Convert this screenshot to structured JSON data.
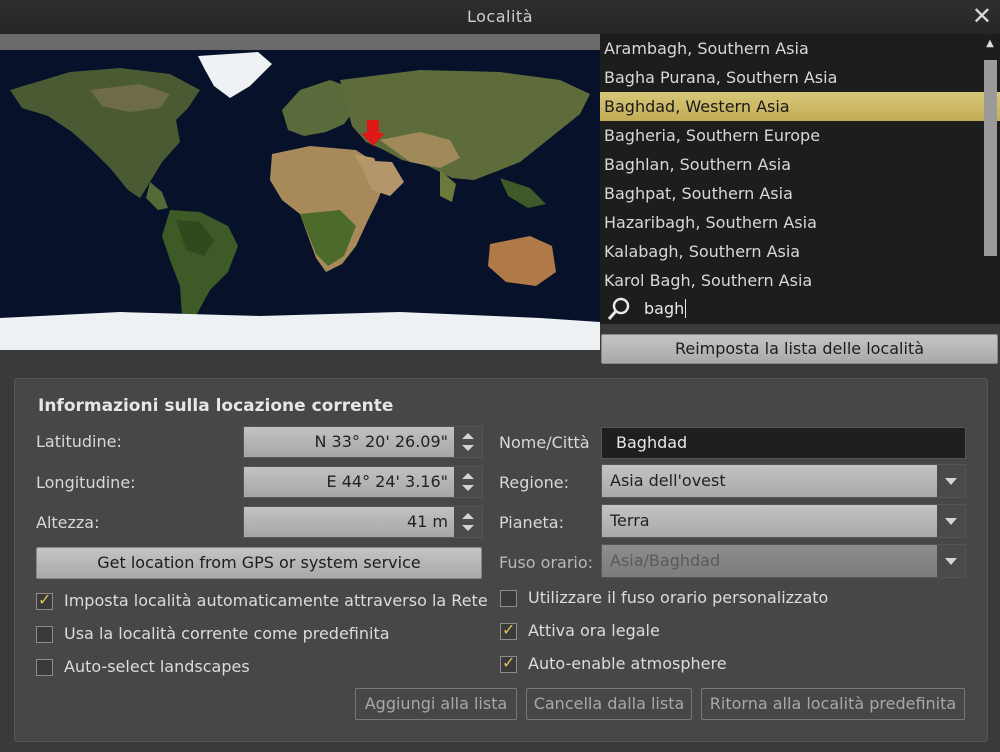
{
  "window": {
    "title": "Località",
    "close_glyph": "✕"
  },
  "locations": [
    "Arambagh, Southern Asia",
    "Bagha Purana, Southern Asia",
    "Baghdad, Western Asia",
    "Bagheria, Southern Europe",
    "Baghlan, Southern Asia",
    "Baghpat, Southern Asia",
    "Hazaribagh, Southern Asia",
    "Kalabagh, Southern Asia",
    "Karol Bagh, Southern Asia"
  ],
  "selected_index": 2,
  "search": {
    "value": "bagh",
    "icon": "search-icon"
  },
  "reset_list_label": "Reimposta la lista delle località",
  "info": {
    "heading": "Informazioni sulla locazione corrente",
    "latitude_label": "Latitudine:",
    "latitude_value": "N 33° 20' 26.09\"",
    "longitude_label": "Longitudine:",
    "longitude_value": "E 44° 24' 3.16\"",
    "altitude_label": "Altezza:",
    "altitude_value": "41 m",
    "gps_button": "Get location from GPS or system service",
    "name_label": "Nome/Città",
    "name_value": "Baghdad",
    "region_label": "Regione:",
    "region_value": "Asia dell'ovest",
    "planet_label": "Pianeta:",
    "planet_value": "Terra",
    "timezone_label": "Fuso orario:",
    "timezone_value": "Asia/Baghdad"
  },
  "checkboxes": {
    "auto_network": {
      "label": "Imposta località automaticamente attraverso la Rete",
      "checked": true
    },
    "use_default": {
      "label": "Usa la località corrente come predefinita",
      "checked": false
    },
    "auto_landscape": {
      "label": "Auto-select landscapes",
      "checked": false
    },
    "custom_tz": {
      "label": "Utilizzare il fuso orario personalizzato",
      "checked": false
    },
    "dst": {
      "label": "Attiva ora legale",
      "checked": true
    },
    "atmosphere": {
      "label": "Auto-enable atmosphere",
      "checked": true
    }
  },
  "buttons": {
    "add": "Aggiungi alla lista",
    "delete": "Cancella dalla lista",
    "return_default": "Ritorna alla località predefinita"
  },
  "colors": {
    "accent": "#d4c06a",
    "marker": "#e01818",
    "checkmark": "#e2c25c"
  }
}
